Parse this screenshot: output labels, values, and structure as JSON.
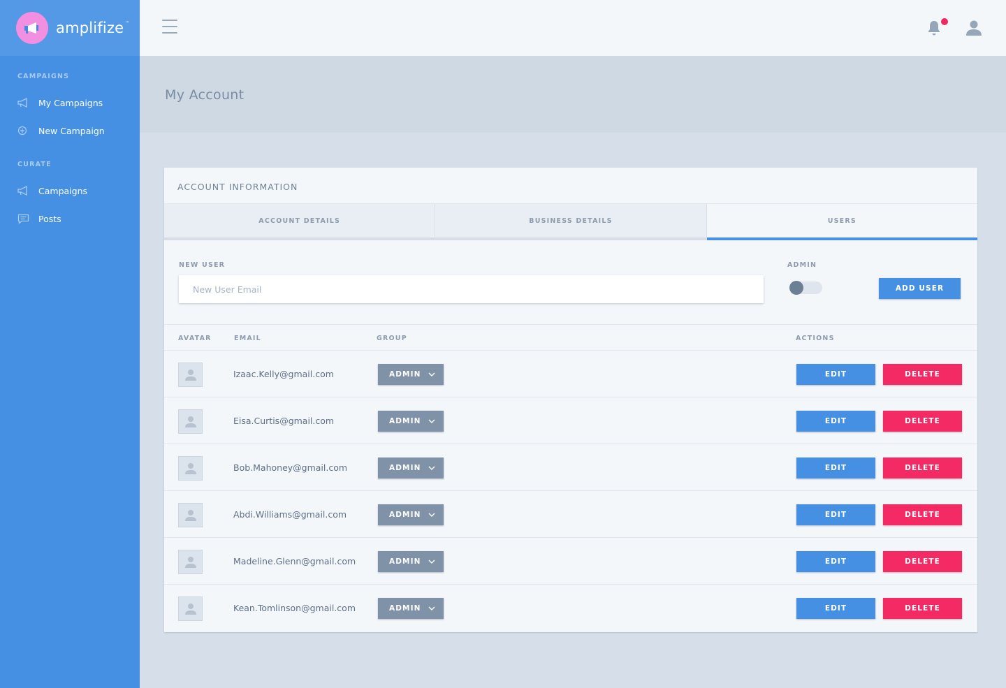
{
  "brand": {
    "name": "amplifize",
    "tm": "™",
    "icon": "megaphone-icon"
  },
  "sidebar": {
    "sections": [
      {
        "label": "CAMPAIGNS",
        "items": [
          {
            "label": "My Campaigns",
            "icon": "megaphone-icon"
          },
          {
            "label": "New Campaign",
            "icon": "plus-circle-icon"
          }
        ]
      },
      {
        "label": "CURATE",
        "items": [
          {
            "label": "Campaigns",
            "icon": "megaphone-icon"
          },
          {
            "label": "Posts",
            "icon": "chat-icon"
          }
        ]
      }
    ]
  },
  "header": {
    "menu_icon": "hamburger-icon",
    "bell_icon": "bell-icon",
    "user_icon": "user-icon"
  },
  "page": {
    "title": "My Account"
  },
  "card": {
    "title": "ACCOUNT INFORMATION",
    "tabs": [
      {
        "label": "ACCOUNT DETAILS",
        "active": false
      },
      {
        "label": "BUSINESS DETAILS",
        "active": false
      },
      {
        "label": "USERS",
        "active": true
      }
    ],
    "new_user": {
      "label": "NEW USER",
      "placeholder": "New User Email",
      "admin_label": "ADMIN",
      "admin_on": false,
      "add_label": "ADD USER"
    },
    "table": {
      "headers": {
        "avatar": "AVATAR",
        "email": "EMAIL",
        "group": "GROUP",
        "actions": "ACTIONS"
      },
      "rows": [
        {
          "email": "Izaac.Kelly@gmail.com",
          "group": "ADMIN"
        },
        {
          "email": "Eisa.Curtis@gmail.com",
          "group": "ADMIN"
        },
        {
          "email": "Bob.Mahoney@gmail.com",
          "group": "ADMIN"
        },
        {
          "email": "Abdi.Williams@gmail.com",
          "group": "ADMIN"
        },
        {
          "email": "Madeline.Glenn@gmail.com",
          "group": "ADMIN"
        },
        {
          "email": "Kean.Tomlinson@gmail.com",
          "group": "ADMIN"
        }
      ],
      "edit_label": "EDIT",
      "delete_label": "DELETE"
    }
  },
  "colors": {
    "primary": "#4590e2",
    "danger": "#f32a63",
    "notify": "#f0275f",
    "logo": "#f28fe0"
  }
}
